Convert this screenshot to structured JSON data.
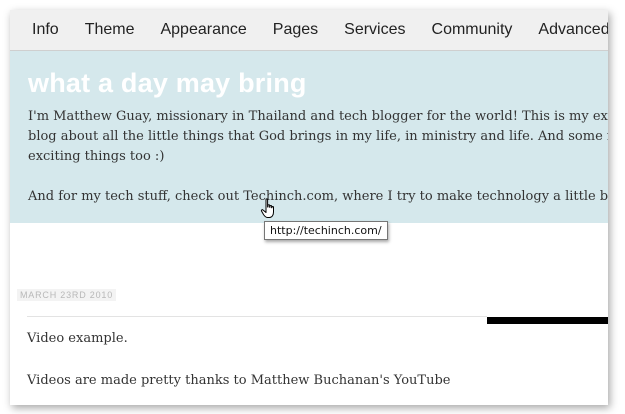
{
  "nav": {
    "items": [
      "Info",
      "Theme",
      "Appearance",
      "Pages",
      "Services",
      "Community",
      "Advanced"
    ]
  },
  "header": {
    "title": "what a day may bring",
    "description_line1": "I'm Matthew Guay, missionary in Thailand and tech blogger for the world! This is my experimen",
    "description_line2": "blog about all the little things that God brings in my life, in ministry and life. And some random,",
    "description_line3": "exciting things too :)",
    "tech_before": "And for my tech stuff, check out ",
    "tech_link": "Techinch.com",
    "tech_after": ", where I try to make technology a little bit simpl"
  },
  "tooltip": {
    "text": "http://techinch.com/"
  },
  "post": {
    "date": "MARCH 23RD 2010",
    "line1": "Video example.",
    "line2": "Videos are made pretty thanks to Matthew Buchanan's YouTube"
  },
  "colors": {
    "header_bg": "#d5e8ec",
    "nav_bg": "#f0f0f0",
    "title_color": "#ffffff"
  }
}
